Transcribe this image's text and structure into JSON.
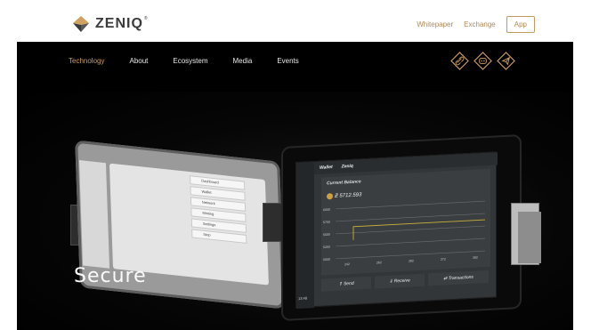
{
  "header": {
    "logo_text": "ZENIQ",
    "logo_mark": "®",
    "links": [
      "Whitepaper",
      "Exchange"
    ],
    "app_button": "App",
    "colors": {
      "accent": "#b18a55",
      "logo": "#3b3b3b"
    }
  },
  "nav": {
    "items": [
      {
        "label": "Technology",
        "active": true
      },
      {
        "label": "About",
        "active": false
      },
      {
        "label": "Ecosystem",
        "active": false
      },
      {
        "label": "Media",
        "active": false
      },
      {
        "label": "Events",
        "active": false
      }
    ]
  },
  "socials": [
    {
      "icon": "link-icon"
    },
    {
      "icon": "discord-icon"
    },
    {
      "icon": "telegram-icon"
    }
  ],
  "hero": {
    "title": "Secure",
    "left_tablet": {
      "menu": [
        "Dashboard",
        "Wallet",
        "Network",
        "Minting",
        "Settings",
        "Stop"
      ]
    },
    "right_tablet": {
      "header_items": [
        "Wallet",
        "Zeniq"
      ],
      "balance_label": "Current Balance",
      "balance_value": "Ƶ 5712.593",
      "buttons": [
        "⇑ Send",
        "⇓ Receive",
        "⇄ Transactions"
      ],
      "time": "13:48",
      "chart": {
        "y_ticks": [
          "6000",
          "5750",
          "5500",
          "5250",
          "5000"
        ],
        "x_ticks": [
          "242",
          "262",
          "282",
          "272",
          "282"
        ],
        "line_color": "#c9b03c"
      }
    }
  }
}
